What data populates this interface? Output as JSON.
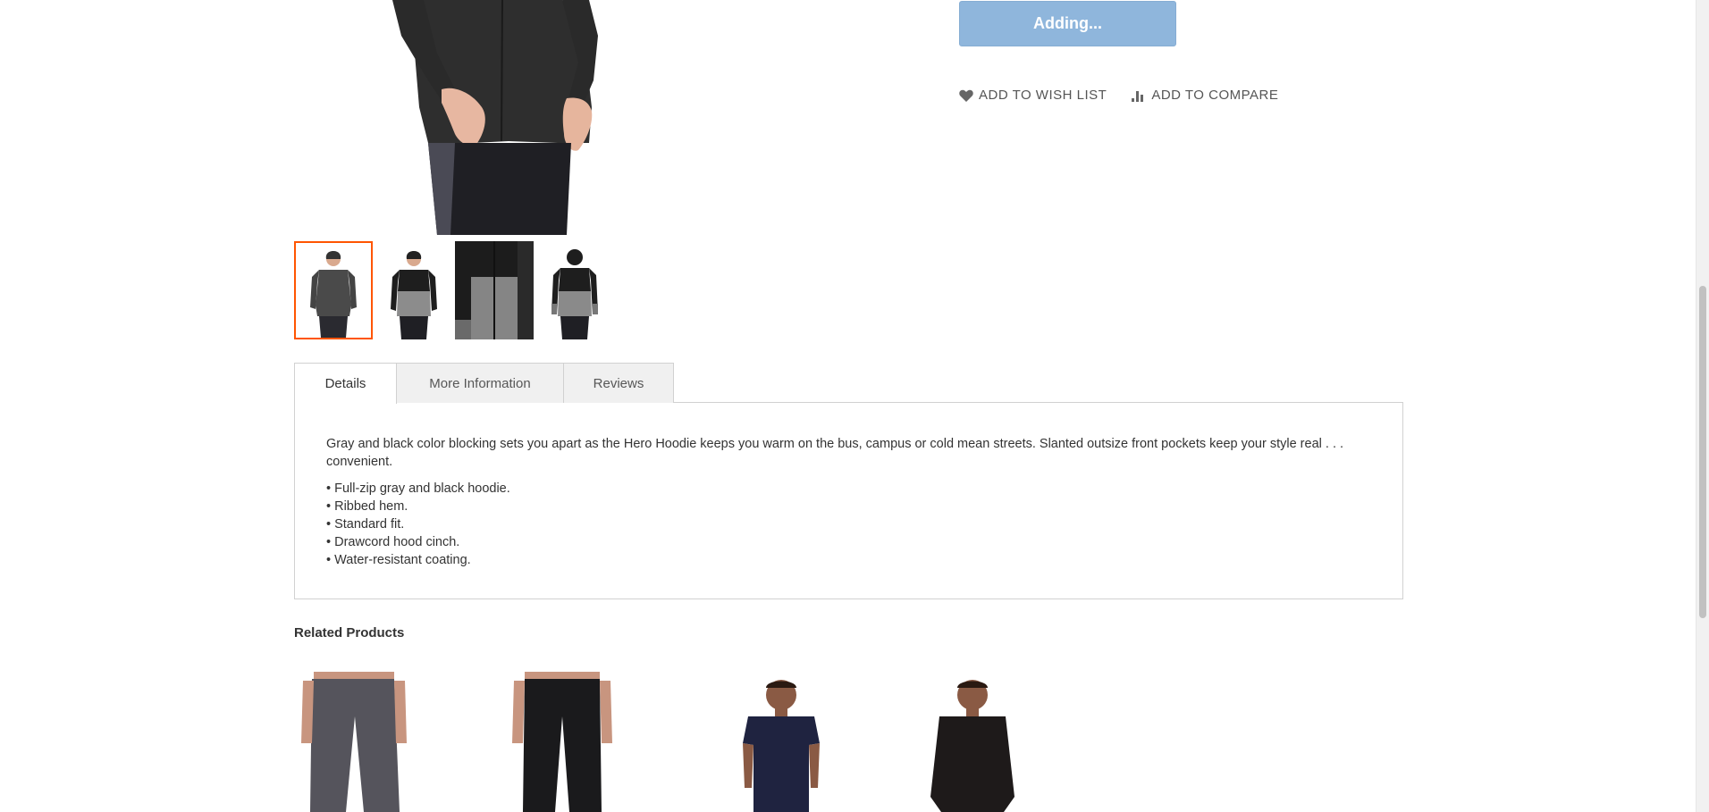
{
  "product": {
    "add_button_label": "Adding...",
    "wishlist_label": "ADD TO WISH LIST",
    "compare_label": "ADD TO COMPARE",
    "wishlist_icon": "heart-icon",
    "compare_icon": "bar-chart-icon"
  },
  "gallery": {
    "thumbnails": [
      {
        "name": "front view gray hoodie",
        "active": true
      },
      {
        "name": "front view black top gray body",
        "active": false
      },
      {
        "name": "close-up zipper detail",
        "active": false
      },
      {
        "name": "back view",
        "active": false
      }
    ]
  },
  "tabs": {
    "items": [
      {
        "label": "Details",
        "active": true
      },
      {
        "label": "More Information",
        "active": false
      },
      {
        "label": "Reviews",
        "active": false
      }
    ],
    "details": {
      "description": "Gray and black color blocking sets you apart as the Hero Hoodie keeps you warm on the bus, campus or cold mean streets. Slanted outsize front pockets keep your style real . . . convenient.",
      "bullets": [
        "• Full-zip gray and black hoodie.",
        "• Ribbed hem.",
        "• Standard fit.",
        "• Drawcord hood cinch.",
        "• Water-resistant coating."
      ]
    }
  },
  "related": {
    "title": "Related Products"
  },
  "colors": {
    "accent": "#ff5501",
    "button_disabled": "#8fb6dc",
    "tab_border": "#d1d1d1"
  }
}
